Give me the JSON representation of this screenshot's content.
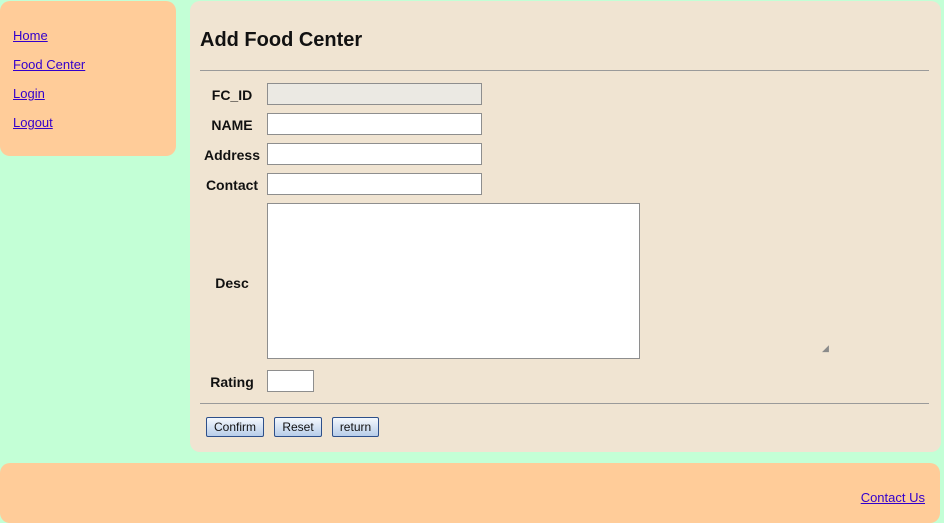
{
  "nav": {
    "items": [
      {
        "label": "Home"
      },
      {
        "label": "Food Center"
      },
      {
        "label": "Login"
      },
      {
        "label": "Logout"
      }
    ]
  },
  "form": {
    "title": "Add Food Center",
    "fields": {
      "fc_id": {
        "label": "FC_ID",
        "value": ""
      },
      "name": {
        "label": "NAME",
        "value": ""
      },
      "address": {
        "label": "Address",
        "value": ""
      },
      "contact": {
        "label": "Contact",
        "value": ""
      },
      "desc": {
        "label": "Desc",
        "value": ""
      },
      "rating": {
        "label": "Rating",
        "value": ""
      }
    },
    "buttons": {
      "confirm": "Confirm",
      "reset": "Reset",
      "return": "return"
    }
  },
  "footer": {
    "contact_link": "Contact Us"
  },
  "colors": {
    "page_background": "#c3ffd6",
    "panel_orange": "#ffcc99",
    "panel_beige": "#f0e4d2",
    "link": "#3300cc"
  }
}
